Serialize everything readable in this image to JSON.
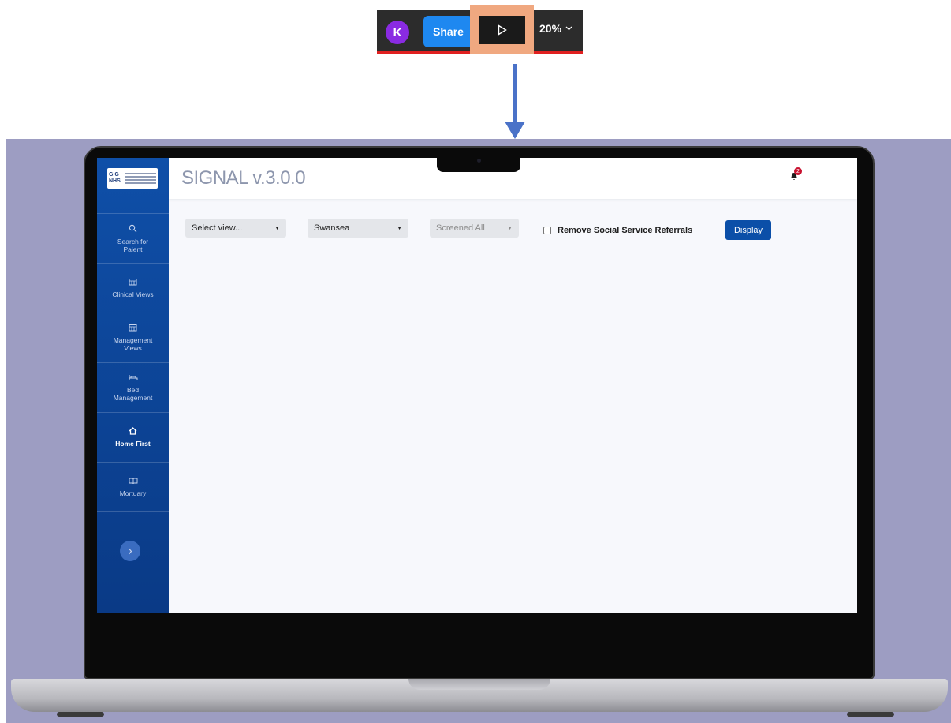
{
  "toolbar": {
    "avatar_initial": "K",
    "share_label": "Share",
    "zoom_label": "20%"
  },
  "app": {
    "title": "SIGNAL v.3.0.0",
    "notification_count": "2",
    "logo_text": "GIG NHS"
  },
  "sidebar": {
    "items": [
      {
        "label": "Search for Paient",
        "icon": "search-icon"
      },
      {
        "label": "Clinical Views",
        "icon": "calendar-icon"
      },
      {
        "label": "Management Views",
        "icon": "calendar-icon"
      },
      {
        "label": "Bed Management",
        "icon": "bed-icon"
      },
      {
        "label": "Home First",
        "icon": "home-icon"
      },
      {
        "label": "Mortuary",
        "icon": "book-icon"
      }
    ],
    "active": "Home First"
  },
  "filters": {
    "view_select": "Select view...",
    "location_select": "Swansea",
    "screened_select": "Screened All",
    "checkbox_label": "Remove Social Service Referrals",
    "display_label": "Display"
  },
  "colors": {
    "sidebar": "#0f4fa8",
    "accent": "#0b4fa8",
    "highlight": "#f0a880",
    "arrow": "#4a72c8"
  }
}
